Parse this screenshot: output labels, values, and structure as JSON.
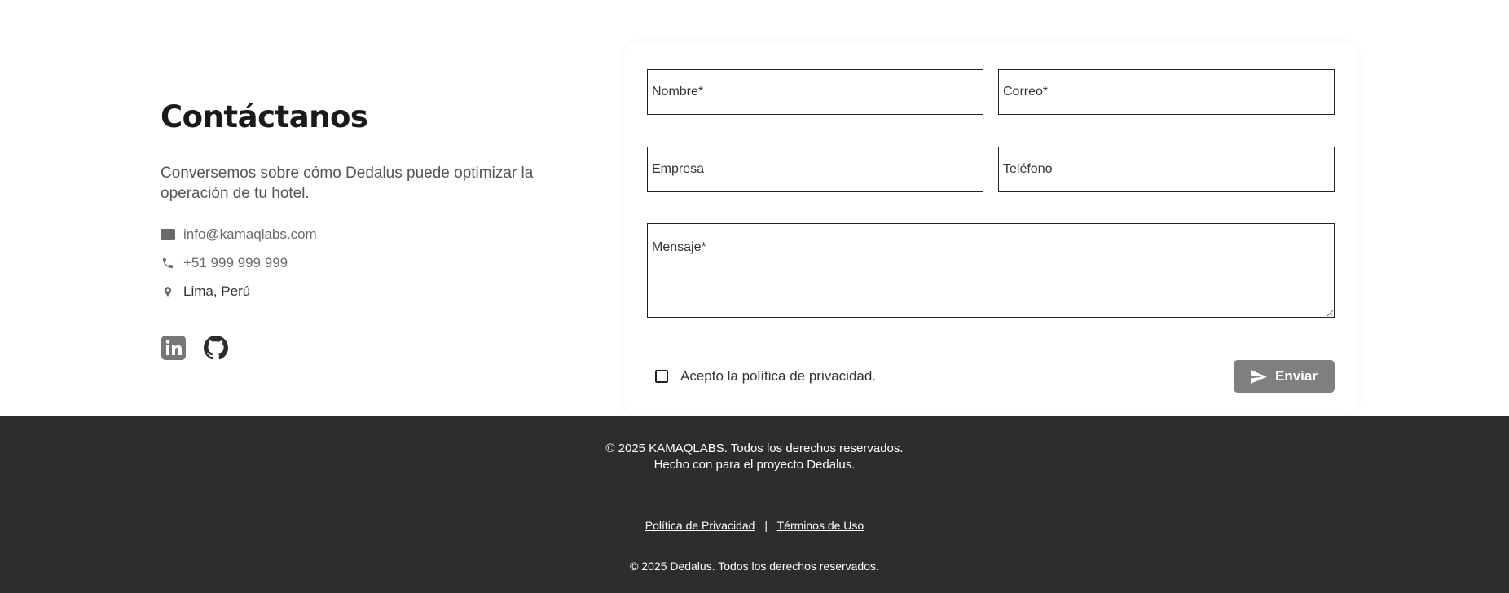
{
  "contact": {
    "title": "Contáctanos",
    "description": "Conversemos sobre cómo Dedalus puede optimizar la operación de tu hotel.",
    "email": "info@kamaqlabs.com",
    "phone": "+51 999 999 999",
    "location": "Lima, Perú",
    "social": [
      {
        "icon": "linkedin-icon"
      },
      {
        "icon": "github-icon"
      }
    ]
  },
  "form": {
    "name_placeholder": "Nombre*",
    "email_placeholder": "Correo*",
    "company_placeholder": "Empresa",
    "phone_placeholder": "Teléfono",
    "message_placeholder": "Mensaje*",
    "privacy_label": "Acepto la política de privacidad.",
    "privacy_checked": false,
    "send_label": "Enviar",
    "send_icon": "send-icon"
  },
  "footer": {
    "copyright_company": "© 2025 KAMAQLABS. Todos los derechos reservados.",
    "made_with": "Hecho con para el proyecto Dedalus.",
    "links": {
      "privacy": "Política de Privacidad",
      "separator": "|",
      "terms": "Términos de Uso"
    },
    "copyright_product": "© 2025 Dedalus. Todos los derechos reservados."
  },
  "colors": {
    "footer_bg": "#2d2d2d",
    "button_bg": "#7f7f7f",
    "text_dark": "#1a1a1a",
    "text_muted": "#555555"
  }
}
